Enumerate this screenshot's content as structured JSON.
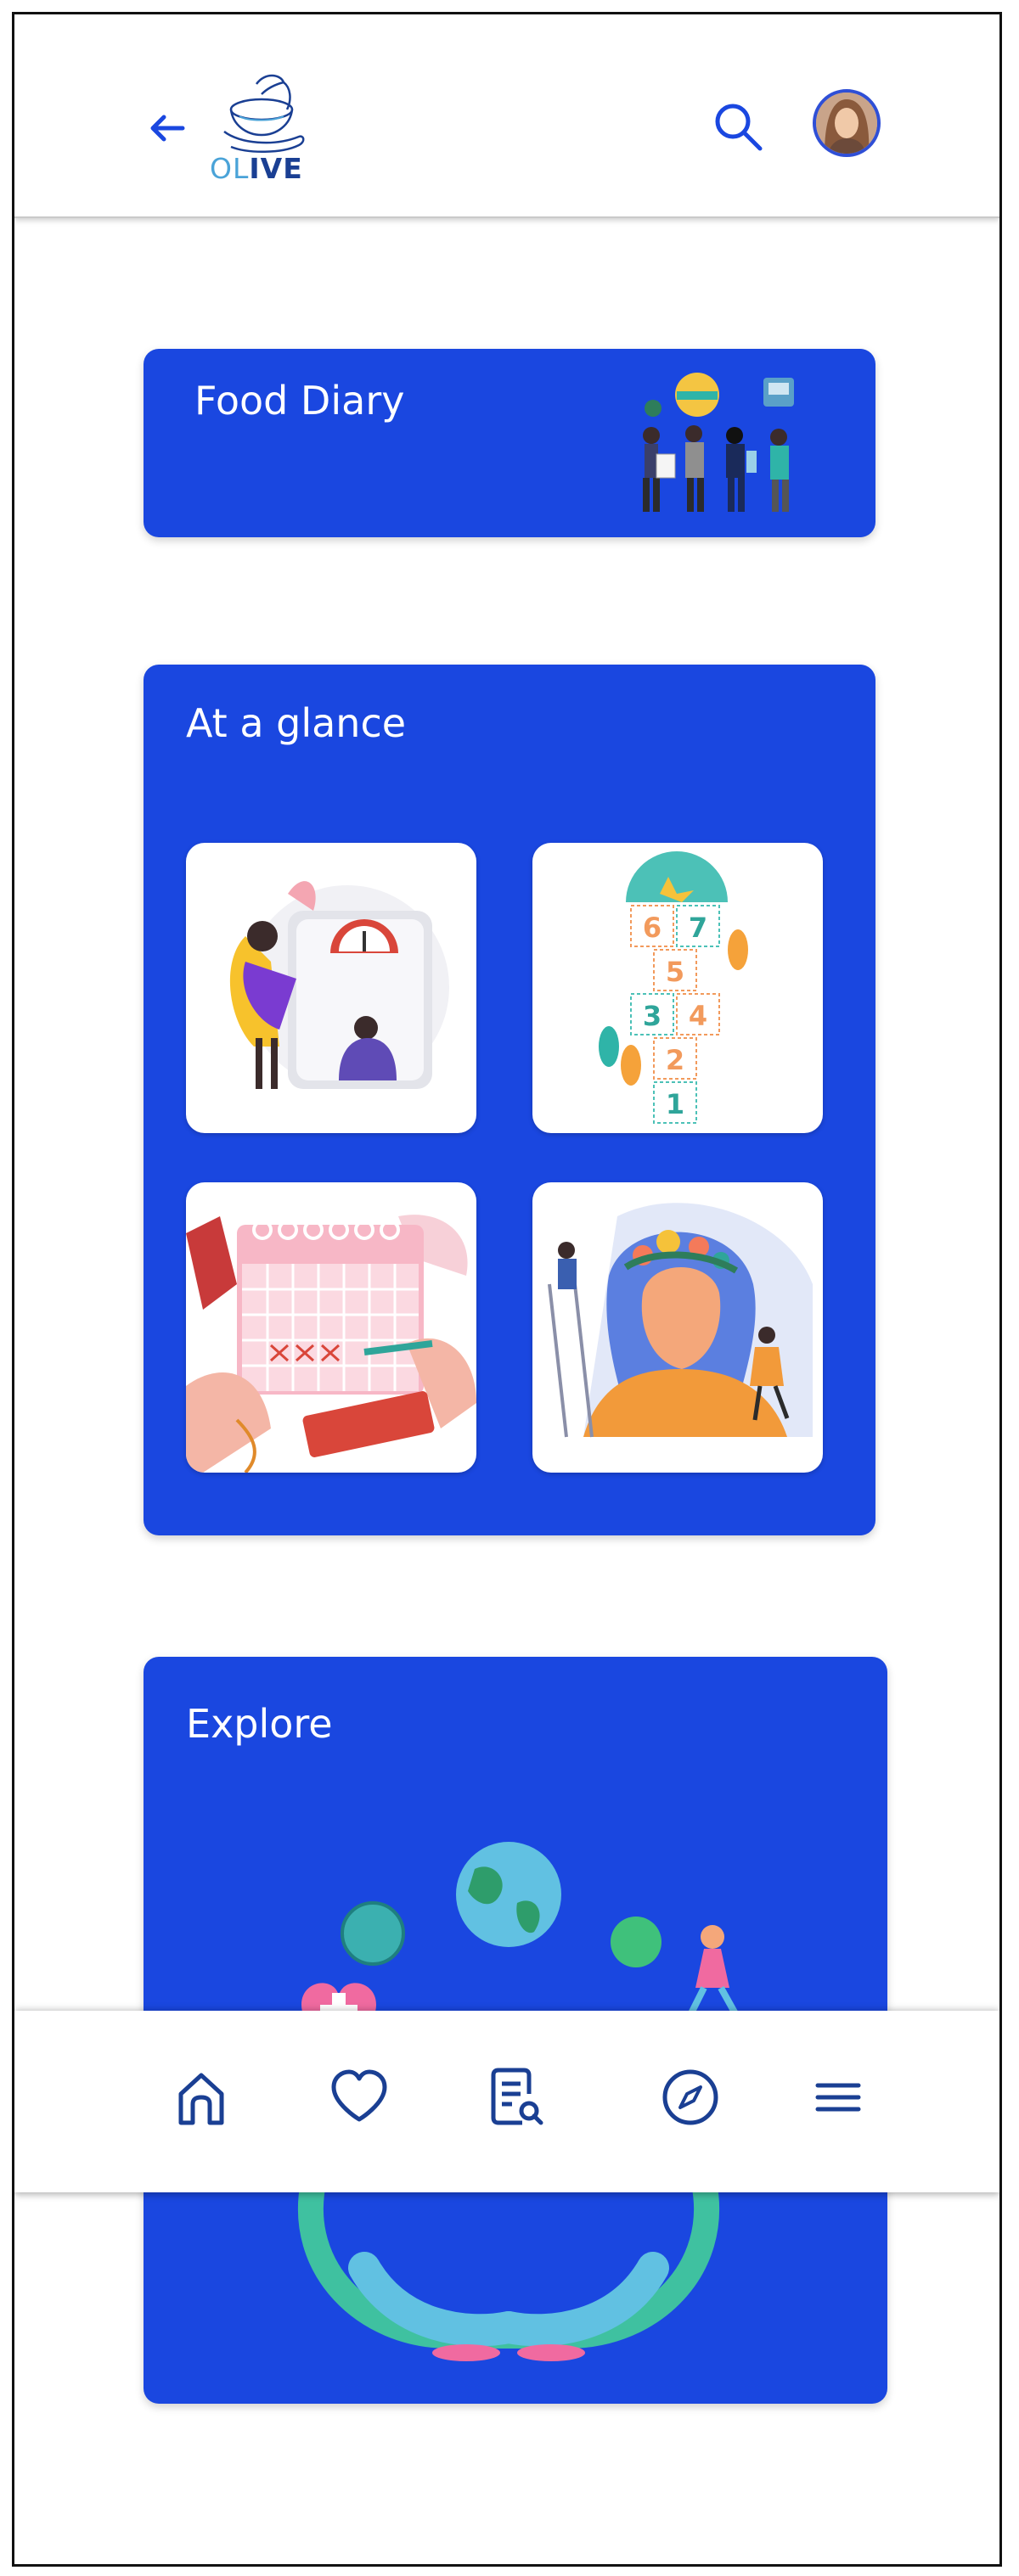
{
  "header": {
    "logo_text_a": "OL",
    "logo_text_b": "IVE"
  },
  "food_diary": {
    "title": "Food Diary"
  },
  "at_a_glance": {
    "title": "At a glance",
    "tiles": [
      {
        "icon": "weight-scale-illustration"
      },
      {
        "icon": "hopscotch-steps-illustration"
      },
      {
        "icon": "calendar-tracking-illustration"
      },
      {
        "icon": "mind-garden-illustration"
      }
    ],
    "hopscotch_numbers": [
      "6",
      "7",
      "5",
      "3",
      "4",
      "2",
      "1"
    ]
  },
  "explore": {
    "title": "Explore"
  },
  "bottom_nav": {
    "items": [
      {
        "icon": "home-icon",
        "active": true
      },
      {
        "icon": "heart-icon"
      },
      {
        "icon": "document-search-icon"
      },
      {
        "icon": "compass-icon"
      },
      {
        "icon": "menu-icon"
      }
    ]
  },
  "colors": {
    "primary": "#1a47e0",
    "icon": "#1a3f93",
    "background": "#ffffff"
  }
}
